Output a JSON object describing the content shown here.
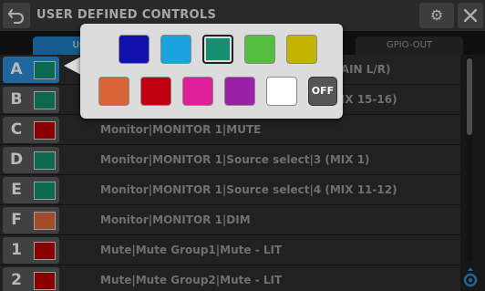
{
  "title": "USER DEFINED CONTROLS",
  "tabs": [
    {
      "label": "User"
    },
    {
      "label": "GPIO-OUT"
    }
  ],
  "rows": [
    {
      "key": "A",
      "color": "#149070",
      "label": "Monitor|MONITOR 1|Source select|1 (MAIN L/R)",
      "selected": true
    },
    {
      "key": "B",
      "color": "#149070",
      "label": "Monitor|MONITOR 1|Source select|2 (MIX 15-16)"
    },
    {
      "key": "C",
      "color": "#c00000",
      "label": "Monitor|MONITOR 1|MUTE"
    },
    {
      "key": "D",
      "color": "#149070",
      "label": "Monitor|MONITOR 1|Source select|3 (MIX 1)"
    },
    {
      "key": "E",
      "color": "#149070",
      "label": "Monitor|MONITOR 1|Source select|4 (MIX 11-12)"
    },
    {
      "key": "F",
      "color": "#e06a3c",
      "label": "Monitor|MONITOR 1|DIM"
    },
    {
      "key": "1",
      "color": "#c00000",
      "label": "Mute|Mute Group1|Mute - LIT"
    },
    {
      "key": "2",
      "color": "#c00000",
      "label": "Mute|Mute Group2|Mute - LIT"
    }
  ],
  "palette": {
    "selected_index": 2,
    "off_label": "OFF",
    "colors": [
      "#1010aa",
      "#1aa3dd",
      "#149070",
      "#55c040",
      "#c2b400",
      "#d86438",
      "#c00010",
      "#e0209a",
      "#9a20a8",
      "#ffffff"
    ]
  },
  "icons": [
    "back-arrow-icon",
    "gear-icon",
    "close-icon",
    "scroll-knob-icon"
  ]
}
